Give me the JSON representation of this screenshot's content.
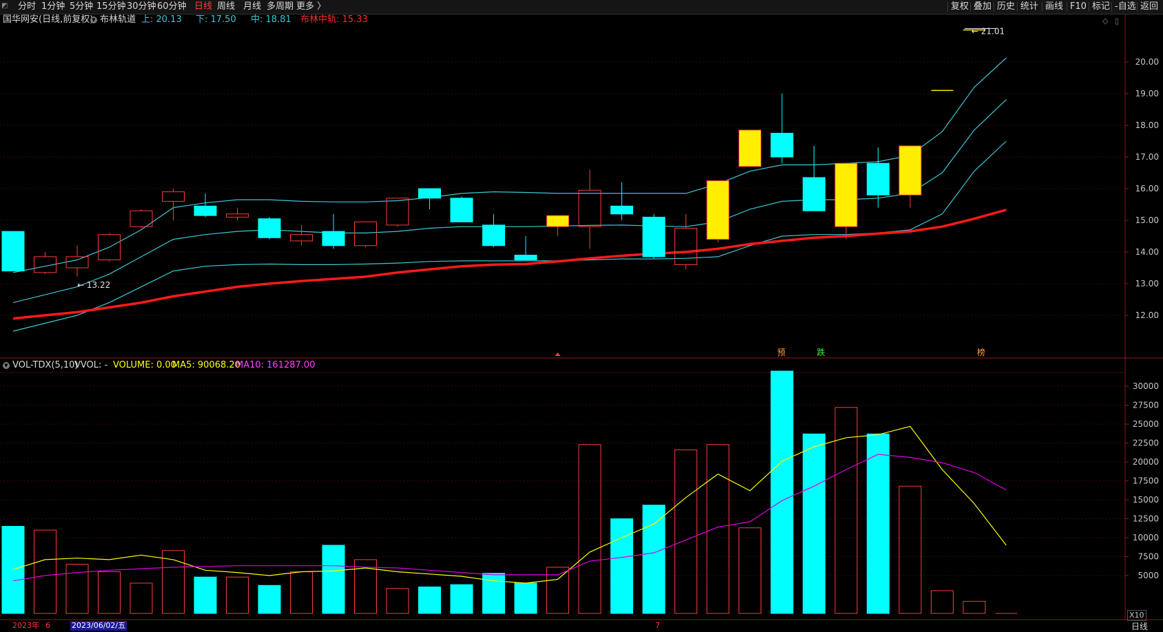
{
  "toolbar": {
    "periods": [
      "分时",
      "1分钟",
      "5分钟",
      "15分钟",
      "30分钟",
      "60分钟",
      "日线",
      "周线",
      "月线",
      "多周期",
      "更多 〉"
    ],
    "active_period": "日线",
    "tools": [
      "复权",
      "叠加",
      "历史",
      "统计",
      "画线",
      "F10",
      "标记",
      "-自选",
      "返回"
    ]
  },
  "price_info": {
    "title": "国华网安(日线,前复权)",
    "indicator_name": "布林轨道",
    "upper": "上: 20.13",
    "lower": "下: 17.50",
    "mid": "中: 18.81",
    "extra": "布林中轨: 15.33"
  },
  "volume_info": {
    "name": "VOL-TDX(5,10)",
    "vvol": "VVOL: -",
    "volume": "VOLUME: 0.00",
    "ma5": "MA5: 90068.20",
    "ma10": "MA10: 161287.00"
  },
  "markers": {
    "high_label": "21.01",
    "low_label": "13.22",
    "tags": [
      "预",
      "跌",
      "榜"
    ]
  },
  "bottom": {
    "year_label": "2023年",
    "month_june": "6",
    "date_label": "2023/06/02/五",
    "month_july": "7",
    "zoom_label": "X10",
    "period_label": "日线"
  },
  "colors": {
    "up": "#ff3b3b",
    "down_fill": "#00ffff",
    "hollow_up_yellow": "#ffee00",
    "boll_line": "#3cc8d8",
    "mid_thick": "#ff1a1a",
    "ma5": "#ffff00",
    "ma10": "#e000e0",
    "axis_text": "#c8c8c8"
  },
  "chart_data": [
    {
      "type": "candlestick",
      "title": "国华网安(日线,前复权)",
      "y_ticks": [
        12,
        13,
        14,
        15,
        16,
        17,
        18,
        19,
        20
      ],
      "ylim": [
        11.6,
        21.3
      ],
      "candles": [
        {
          "o": 14.65,
          "c": 13.4,
          "h": 14.65,
          "l": 13.4,
          "style": "down"
        },
        {
          "o": 13.35,
          "c": 13.85,
          "h": 14.0,
          "l": 13.3,
          "style": "up"
        },
        {
          "o": 13.5,
          "c": 13.85,
          "h": 14.2,
          "l": 13.22,
          "style": "up"
        },
        {
          "o": 13.75,
          "c": 14.55,
          "h": 14.6,
          "l": 13.7,
          "style": "up"
        },
        {
          "o": 14.8,
          "c": 15.3,
          "h": 15.35,
          "l": 14.75,
          "style": "up"
        },
        {
          "o": 15.6,
          "c": 15.9,
          "h": 16.0,
          "l": 15.0,
          "style": "up"
        },
        {
          "o": 15.45,
          "c": 15.15,
          "h": 15.85,
          "l": 15.1,
          "style": "down"
        },
        {
          "o": 15.1,
          "c": 15.2,
          "h": 15.4,
          "l": 15.0,
          "style": "up"
        },
        {
          "o": 15.05,
          "c": 14.45,
          "h": 15.1,
          "l": 14.4,
          "style": "down"
        },
        {
          "o": 14.35,
          "c": 14.55,
          "h": 14.85,
          "l": 14.2,
          "style": "up"
        },
        {
          "o": 14.65,
          "c": 14.2,
          "h": 15.2,
          "l": 14.1,
          "style": "down"
        },
        {
          "o": 14.2,
          "c": 14.95,
          "h": 14.95,
          "l": 14.15,
          "style": "up"
        },
        {
          "o": 14.85,
          "c": 15.7,
          "h": 15.7,
          "l": 14.8,
          "style": "up"
        },
        {
          "o": 16.0,
          "c": 15.7,
          "h": 16.0,
          "l": 15.35,
          "style": "down"
        },
        {
          "o": 15.7,
          "c": 14.95,
          "h": 15.75,
          "l": 14.95,
          "style": "down"
        },
        {
          "o": 14.85,
          "c": 14.2,
          "h": 15.2,
          "l": 14.15,
          "style": "down"
        },
        {
          "o": 13.9,
          "c": 13.75,
          "h": 14.5,
          "l": 13.75,
          "style": "down"
        },
        {
          "o": 14.8,
          "c": 15.15,
          "h": 15.15,
          "l": 14.5,
          "style": "upy"
        },
        {
          "o": 14.8,
          "c": 15.95,
          "h": 16.6,
          "l": 14.1,
          "style": "up"
        },
        {
          "o": 15.45,
          "c": 15.2,
          "h": 16.2,
          "l": 15.0,
          "style": "down"
        },
        {
          "o": 15.1,
          "c": 13.85,
          "h": 15.2,
          "l": 13.8,
          "style": "down"
        },
        {
          "o": 13.6,
          "c": 14.75,
          "h": 15.2,
          "l": 13.45,
          "style": "up"
        },
        {
          "o": 14.4,
          "c": 16.25,
          "h": 16.25,
          "l": 14.3,
          "style": "upy"
        },
        {
          "o": 16.7,
          "c": 17.85,
          "h": 17.85,
          "l": 16.7,
          "style": "upy"
        },
        {
          "o": 17.75,
          "c": 17.0,
          "h": 19.0,
          "l": 16.8,
          "style": "down"
        },
        {
          "o": 16.35,
          "c": 15.3,
          "h": 17.35,
          "l": 15.3,
          "style": "down"
        },
        {
          "o": 14.8,
          "c": 16.8,
          "h": 16.8,
          "l": 14.4,
          "style": "upy"
        },
        {
          "o": 16.8,
          "c": 15.8,
          "h": 17.3,
          "l": 15.4,
          "style": "down"
        },
        {
          "o": 15.8,
          "c": 17.35,
          "h": 17.35,
          "l": 15.4,
          "style": "upy"
        },
        {
          "o": 19.1,
          "c": 19.1,
          "h": 19.1,
          "l": 19.1,
          "style": "flat"
        },
        {
          "o": 21.01,
          "c": 21.01,
          "h": 21.01,
          "l": 21.01,
          "style": "flat"
        }
      ],
      "boll_upper": [
        13.35,
        13.55,
        13.75,
        14.15,
        14.7,
        15.4,
        15.55,
        15.65,
        15.65,
        15.6,
        15.58,
        15.58,
        15.62,
        15.72,
        15.85,
        15.9,
        15.88,
        15.85,
        15.85,
        15.85,
        15.85,
        15.85,
        16.15,
        16.55,
        16.75,
        16.75,
        16.8,
        16.85,
        17.05,
        17.8,
        19.2,
        20.13
      ],
      "boll_mid": [
        12.4,
        12.65,
        12.9,
        13.3,
        13.85,
        14.4,
        14.55,
        14.65,
        14.7,
        14.65,
        14.6,
        14.6,
        14.65,
        14.75,
        14.8,
        14.8,
        14.8,
        14.82,
        14.84,
        14.85,
        14.82,
        14.8,
        14.95,
        15.35,
        15.6,
        15.65,
        15.65,
        15.7,
        15.85,
        16.5,
        17.85,
        18.81
      ],
      "boll_lower": [
        11.5,
        11.75,
        12.0,
        12.4,
        12.9,
        13.4,
        13.55,
        13.6,
        13.62,
        13.6,
        13.6,
        13.62,
        13.65,
        13.7,
        13.72,
        13.72,
        13.72,
        13.72,
        13.75,
        13.78,
        13.78,
        13.8,
        13.85,
        14.2,
        14.5,
        14.55,
        14.55,
        14.6,
        14.7,
        15.2,
        16.55,
        17.5
      ],
      "boll_mid_thick": [
        11.9,
        12.0,
        12.1,
        12.25,
        12.4,
        12.6,
        12.75,
        12.9,
        13.0,
        13.08,
        13.15,
        13.22,
        13.35,
        13.45,
        13.55,
        13.6,
        13.62,
        13.7,
        13.8,
        13.88,
        13.95,
        14.0,
        14.1,
        14.25,
        14.35,
        14.45,
        14.5,
        14.58,
        14.65,
        14.8,
        15.05,
        15.33
      ]
    },
    {
      "type": "bar",
      "title": "VOL-TDX(5,10)",
      "y_ticks": [
        5000,
        7500,
        10000,
        12500,
        15000,
        17500,
        20000,
        22500,
        25000,
        27500,
        30000
      ],
      "ylim": [
        0,
        33000
      ],
      "series": [
        {
          "name": "VOLUME",
          "values": [
            11500,
            11000,
            6500,
            5500,
            4000,
            8300,
            4800,
            4800,
            3700,
            5500,
            9000,
            7100,
            3300,
            3500,
            3800,
            5300,
            4000,
            6100,
            22300,
            12500,
            14300,
            21600,
            22300,
            11300,
            32000,
            23700,
            27200,
            23700,
            16800,
            3000,
            1600,
            0
          ]
        },
        {
          "name": "MA5",
          "values": [
            5800,
            7100,
            7300,
            7100,
            7700,
            7100,
            5700,
            5400,
            5000,
            5500,
            5600,
            6000,
            5500,
            5200,
            4900,
            4300,
            4000,
            4500,
            8100,
            10000,
            11800,
            15300,
            18400,
            16200,
            20100,
            22000,
            23200,
            23600,
            24700,
            19000,
            14500,
            9000
          ]
        },
        {
          "name": "MA10",
          "values": [
            4300,
            5000,
            5400,
            5700,
            5900,
            6100,
            6200,
            6300,
            6300,
            6300,
            6300,
            6100,
            6000,
            5700,
            5400,
            5100,
            5100,
            5100,
            6900,
            7400,
            8000,
            9700,
            11400,
            12100,
            14900,
            16800,
            19000,
            21000,
            20600,
            19900,
            18600,
            16300
          ]
        }
      ],
      "bar_styles": [
        "d",
        "u",
        "u",
        "u",
        "u",
        "u",
        "d",
        "u",
        "d",
        "u",
        "d",
        "u",
        "u",
        "d",
        "d",
        "d",
        "d",
        "u",
        "u",
        "d",
        "d",
        "u",
        "u",
        "u",
        "d",
        "d",
        "u",
        "d",
        "u",
        "u",
        "u",
        "u"
      ]
    }
  ]
}
